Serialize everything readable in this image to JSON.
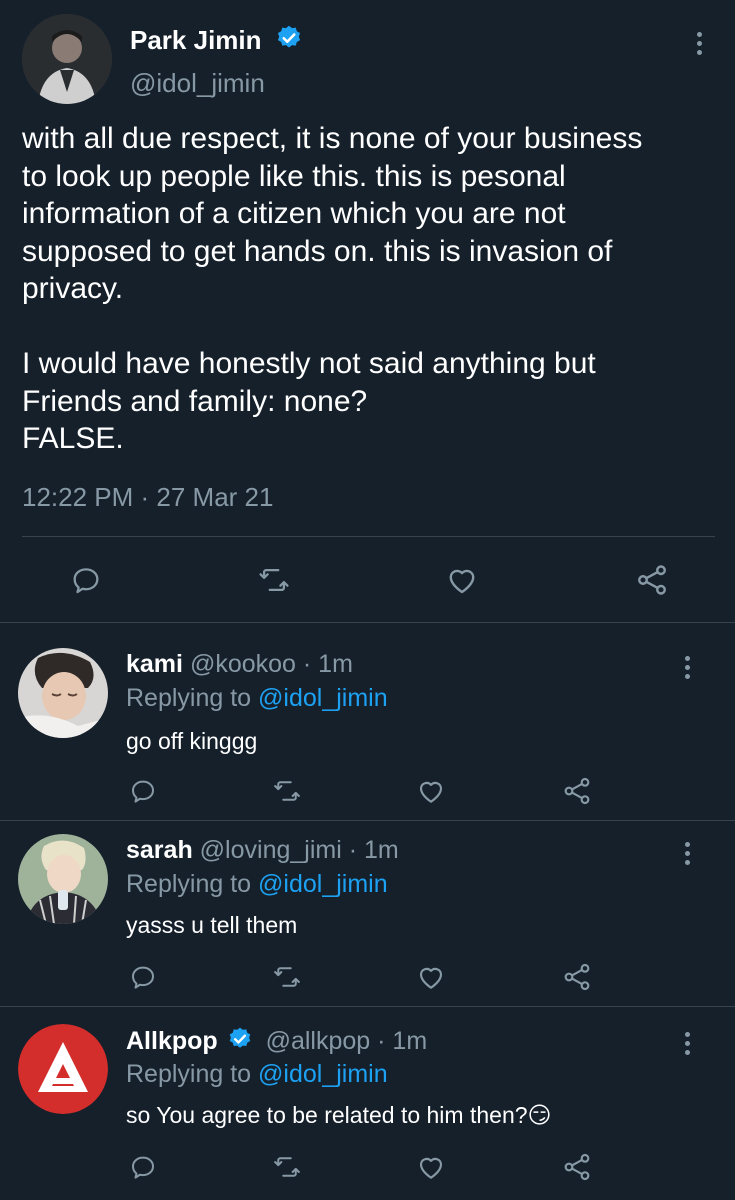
{
  "main_tweet": {
    "name": "Park Jimin",
    "handle": "@idol_jimin",
    "text": "with all due respect, it is none of your business\nto look up people like this. this is pesonal\ninformation of a citizen which you are not\nsupposed to get hands on. this is invasion of\nprivacy.\n\nI would have honestly not said anything but\nFriends and family: none?\nFALSE.",
    "timestamp": "12:22 PM · 27 Mar 21",
    "actions": [
      "reply-icon",
      "retweet-icon",
      "like-icon",
      "share-icon"
    ]
  },
  "replies": [
    {
      "name": "kami",
      "handle": "@kookoo",
      "time": "· 1m",
      "replying_prefix": "Replying to",
      "replying_to": "@idol_jimin",
      "text": "go off kinggg",
      "verified": false
    },
    {
      "name": "sarah",
      "handle": "@loving_jimi",
      "time": "· 1m",
      "replying_prefix": "Replying to",
      "replying_to": "@idol_jimin",
      "text": "yasss u tell them",
      "verified": false
    },
    {
      "name": "Allkpop",
      "handle": "@allkpop",
      "time": "· 1m",
      "replying_prefix": "Replying to",
      "replying_to": "@idol_jimin",
      "text": "so You agree to be related to him then?😏",
      "verified": true
    }
  ],
  "colors": {
    "background": "#15202b",
    "muted": "#8899a6",
    "accent": "#1da1f2",
    "divider": "#38444d",
    "allkpop_red": "#d32e2b"
  }
}
